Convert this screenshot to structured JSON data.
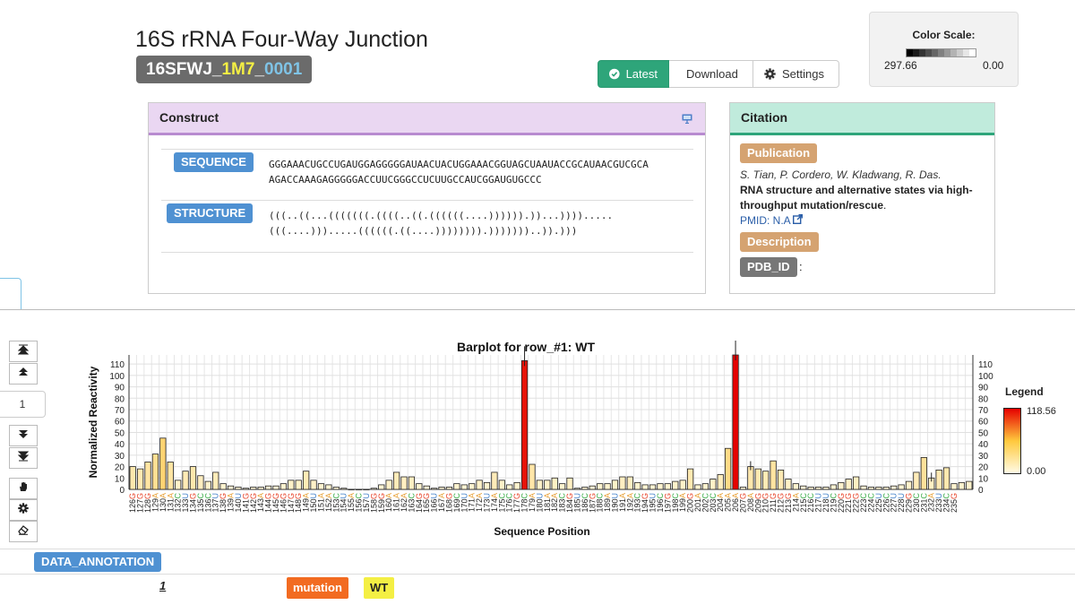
{
  "header": {
    "title": "16S rRNA Four-Way Junction",
    "entry_id_parts": [
      {
        "text": "16SFWJ_",
        "color": "#ffffff"
      },
      {
        "text": "1M7",
        "color": "#f4ef44"
      },
      {
        "text": "_",
        "color": "#ffffff"
      },
      {
        "text": "0001",
        "color": "#7fc3e6"
      }
    ]
  },
  "toolbar": {
    "latest_label": "Latest",
    "download_label": "Download",
    "settings_label": "Settings"
  },
  "color_scale": {
    "label": "Color Scale:",
    "min_label": "297.66",
    "max_label": "0.00"
  },
  "construct": {
    "title": "Construct",
    "sequence_label": "SEQUENCE",
    "sequence_lines": [
      "GGGAAACUGCCUGAUGGAGGGGGAUAACUACUGGAAACGGUAGCUAAUACCGCAUAACGUCGCA",
      "AGACCAAAGAGGGGGACCUUCGGGCCUCUUGCCAUCGGAUGUGCCC"
    ],
    "structure_label": "STRUCTURE",
    "structure_lines": [
      "(((..((...(((((((.((((..((.((((((....)))))).))...)))).....",
      "(((....))).....((((((.((....)))))))).)))))))..)).)))"
    ]
  },
  "citation": {
    "title": "Citation",
    "publication_label": "Publication",
    "authors": "S. Tian, P. Cordero, W. Kladwang, R. Das.",
    "paper_title_1": "RNA structure and alternative states via high-",
    "paper_title_2": "throughput mutation/rescue",
    "paper_title_end": ".",
    "pmid": "PMID: N.A",
    "description_label": "Description",
    "pdb_label": "PDB_ID",
    "pdb_value": ":"
  },
  "sidebar": {
    "page_number": "1"
  },
  "annotation": {
    "label": "DATA_ANNOTATION",
    "row_number": "1",
    "tag_mutation": "mutation",
    "tag_wt": "WT"
  },
  "chart_legend": {
    "title": "Legend",
    "max_label": "118.56",
    "min_label": "0.00"
  },
  "chart_data": {
    "type": "bar",
    "title": "Barplot for row_#1: WT",
    "xlabel": "Sequence Position",
    "ylabel": "Normalized Reactivity",
    "ylim": [
      0,
      118
    ],
    "y_ticks": [
      0,
      10,
      20,
      30,
      40,
      50,
      60,
      70,
      80,
      90,
      100,
      110
    ],
    "grid": true,
    "legend_placement": "right",
    "color_scale": {
      "min": 0.0,
      "max": 118.56,
      "low_color": "#fffbe6",
      "mid_color": "#ffd04a",
      "high_color": "#e60000"
    },
    "nucleotide_colors": {
      "G": "#e8452c",
      "A": "#e8a33d",
      "U": "#3e7ec8",
      "C": "#3cae4a"
    },
    "categories": [
      "126G",
      "127G",
      "128G",
      "129A",
      "130A",
      "131A",
      "132C",
      "133U",
      "134G",
      "135C",
      "136C",
      "137U",
      "138G",
      "139A",
      "140U",
      "141G",
      "142G",
      "143A",
      "144G",
      "145G",
      "146G",
      "147G",
      "148G",
      "149A",
      "150U",
      "151A",
      "152A",
      "153C",
      "154U",
      "155A",
      "156C",
      "157U",
      "158G",
      "159G",
      "160A",
      "161A",
      "162A",
      "163C",
      "164G",
      "165G",
      "166U",
      "167A",
      "168G",
      "169C",
      "170U",
      "171A",
      "172A",
      "173U",
      "174A",
      "175C",
      "176C",
      "177G",
      "178C",
      "179A",
      "180U",
      "181A",
      "182A",
      "183C",
      "184G",
      "185U",
      "186C",
      "187G",
      "188C",
      "189A",
      "190U",
      "191A",
      "192A",
      "193C",
      "194G",
      "195U",
      "196C",
      "197G",
      "198C",
      "199A",
      "200G",
      "201A",
      "202C",
      "203C",
      "204A",
      "205A",
      "206A",
      "207G",
      "208A",
      "209G",
      "210G",
      "211G",
      "212G",
      "213G",
      "214A",
      "215C",
      "216C",
      "217U",
      "218U",
      "219C",
      "220G",
      "221G",
      "222G",
      "223C",
      "224C",
      "225U",
      "226C",
      "227U",
      "228U",
      "229G",
      "230C",
      "231C",
      "232A",
      "233U",
      "234C",
      "235G"
    ],
    "values": [
      20,
      18,
      24,
      31,
      45,
      24,
      8,
      16,
      20,
      12,
      7,
      15,
      5,
      3,
      2,
      1,
      2,
      2,
      3,
      3,
      5,
      8,
      8,
      16,
      8,
      5,
      4,
      2,
      1,
      0,
      0,
      0,
      1,
      4,
      8,
      15,
      11,
      11,
      5,
      3,
      1,
      2,
      2,
      5,
      4,
      5,
      8,
      6,
      15,
      8,
      4,
      6,
      113,
      22,
      8,
      8,
      10,
      5,
      10,
      1,
      2,
      3,
      5,
      5,
      8,
      11,
      11,
      6,
      4,
      4,
      5,
      5,
      7,
      8,
      18,
      4,
      5,
      9,
      13,
      36,
      118,
      2,
      20,
      18,
      16,
      25,
      17,
      9,
      5,
      3,
      2,
      2,
      2,
      4,
      6,
      9,
      11,
      3,
      2,
      2,
      2,
      3,
      4,
      7,
      15,
      28,
      10,
      17,
      19,
      5,
      6,
      7
    ]
  }
}
